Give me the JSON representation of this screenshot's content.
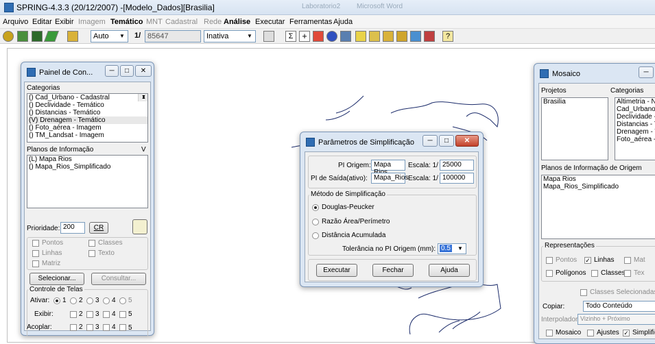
{
  "app": {
    "title": "SPRING-4.3.3 (20/12/2007) -[Modelo_Dados][Brasilia]",
    "ghost_tab1": "Laboratorio2",
    "ghost_tab2": "Microsoft Word"
  },
  "menu": [
    {
      "label": "Arquivo",
      "state": "normal"
    },
    {
      "label": "Editar",
      "state": "normal"
    },
    {
      "label": "Exibir",
      "state": "normal"
    },
    {
      "label": "Imagem",
      "state": "disabled"
    },
    {
      "label": "Temático",
      "state": "bold"
    },
    {
      "label": "MNT",
      "state": "disabled"
    },
    {
      "label": "Cadastral",
      "state": "disabled"
    },
    {
      "label": "Rede",
      "state": "disabled"
    },
    {
      "label": "Análise",
      "state": "bold"
    },
    {
      "label": "Executar",
      "state": "normal"
    },
    {
      "label": "Ferramentas",
      "state": "normal"
    },
    {
      "label": "Ajuda",
      "state": "normal"
    }
  ],
  "toolbar": {
    "mode_value": "Auto",
    "scale_prefix": "1/",
    "scale_value": "85647",
    "state_value": "Inativa"
  },
  "painel": {
    "title": "Painel de Con...",
    "categorias_label": "Categorias",
    "categorias": [
      "() Cad_Urbano - Cadastral",
      "() Declividade - Temático",
      "() Distancias - Temático",
      "(V) Drenagem - Temático",
      "() Foto_aérea - Imagem",
      "() TM_Landsat - Imagem"
    ],
    "selected_categoria": "(V) Drenagem - Temático",
    "planos_label": "Planos de Informação",
    "planos_v": "V",
    "planos": [
      "(L) Mapa Rios",
      "() Mapa_Rios_Simplificado"
    ],
    "prioridade_label": "Prioridade:",
    "prioridade_value": "200",
    "cr_label": "CR",
    "opts": {
      "pontos": "Pontos",
      "classes": "Classes",
      "linhas": "Linhas",
      "texto": "Texto",
      "matriz": "Matriz"
    },
    "selecionar": "Selecionar...",
    "consultar": "Consultar...",
    "controle_label": "Controle de Telas",
    "ativar_label": "Ativar:",
    "exibir_label": "Exibir:",
    "acoplar_label": "Acoplar:",
    "nums": [
      "1",
      "2",
      "3",
      "4",
      "5"
    ]
  },
  "dialog": {
    "title": "Parâmetros de Simplificação",
    "pi_origem_label": "PI Origem:",
    "pi_origem_value": "Mapa Rios",
    "pi_saida_label": "PI de Saída(ativo):",
    "pi_saida_value": "Mapa_Rios",
    "escala_label": "Escala: 1/",
    "escala_origem": "25000",
    "escala_saida": "100000",
    "metodo_label": "Método de Simplificação",
    "metodos": [
      "Douglas-Peucker",
      "Razão Área/Perímetro",
      "Distância Acumulada"
    ],
    "selected_metodo": "Douglas-Peucker",
    "tolerancia_label": "Tolerância no PI Origem (mm):",
    "tolerancia_value": "0.5",
    "executar": "Executar",
    "fechar": "Fechar",
    "ajuda": "Ajuda"
  },
  "mosaico": {
    "title": "Mosaico",
    "projetos_label": "Projetos",
    "categorias_label": "Categorias",
    "projetos": [
      "Brasilia"
    ],
    "categorias": [
      "Altimetria - Nur",
      "Cad_Urbano -",
      "Declividade - T",
      "Distancias - Te",
      "Drenagem - Te",
      "Foto_aérea - Ir"
    ],
    "planos_label": "Planos de Informação de Origem",
    "planos": [
      "Mapa Rios",
      "Mapa_Rios_Simplificado"
    ],
    "representacoes_label": "Representações",
    "rep": {
      "pontos": "Pontos",
      "linhas": "Linhas",
      "mat": "Mat",
      "poligonos": "Polígonos",
      "classes": "Classes",
      "tex": "Tex"
    },
    "classes_sel": "Classes Selecionadas",
    "copiar_label": "Copiar:",
    "copiar_value": "Todo Conteúdo",
    "interpolador_label": "Interpolador:",
    "interpolador_value": "Vizinho + Próximo",
    "mosaico_opt": "Mosaico",
    "ajustes_opt": "Ajustes",
    "simplific_opt": "Simplific"
  }
}
